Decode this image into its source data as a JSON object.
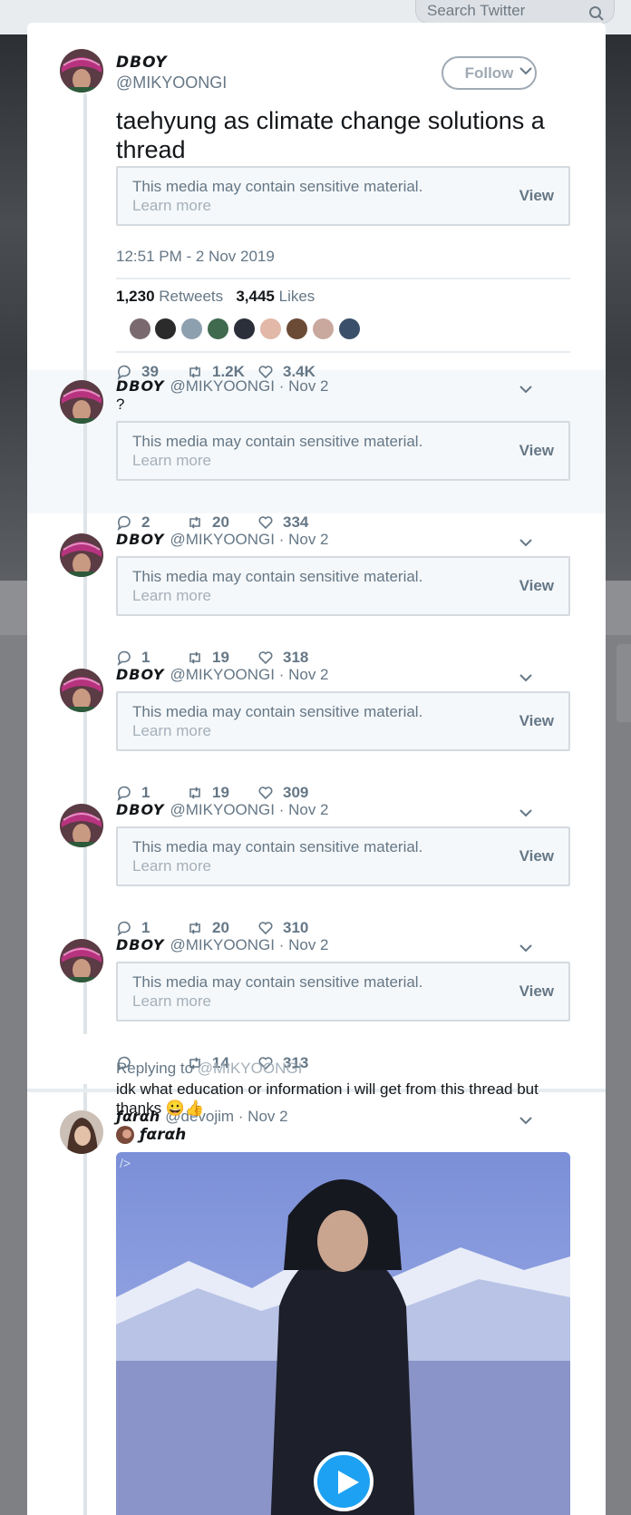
{
  "search": {
    "placeholder": "Search Twitter",
    "icon": "search-icon"
  },
  "main_tweet": {
    "name": "DBOY",
    "handle": "@MIKYOONGI",
    "follow_label": "Follow",
    "text": "taehyung as climate change solutions a thread",
    "media_notice": "This media may contain sensitive material.",
    "learn_more": "Learn more",
    "view_label": "View",
    "timestamp": "12:51 PM - 2 Nov 2019",
    "retweets_count": "1,230",
    "retweets_label": "Retweets",
    "likes_count": "3,445",
    "likes_label": "Likes",
    "replies": "39",
    "retweets_short": "1.2K",
    "likes_short": "3.4K"
  },
  "thread": [
    {
      "name": "DBOY",
      "handle": "@MIKYOONGI · Nov 2",
      "text": "?",
      "media_notice": "This media may contain sensitive material.",
      "learn_more": "Learn more",
      "view_label": "View",
      "replies": "2",
      "retweets": "20",
      "likes": "334"
    },
    {
      "name": "DBOY",
      "handle": "@MIKYOONGI · Nov 2",
      "media_notice": "This media may contain sensitive material.",
      "learn_more": "Learn more",
      "view_label": "View",
      "replies": "1",
      "retweets": "19",
      "likes": "318"
    },
    {
      "name": "DBOY",
      "handle": "@MIKYOONGI · Nov 2",
      "media_notice": "This media may contain sensitive material.",
      "learn_more": "Learn more",
      "view_label": "View",
      "replies": "1",
      "retweets": "19",
      "likes": "309"
    },
    {
      "name": "DBOY",
      "handle": "@MIKYOONGI · Nov 2",
      "media_notice": "This media may contain sensitive material.",
      "learn_more": "Learn more",
      "view_label": "View",
      "replies": "1",
      "retweets": "20",
      "likes": "310"
    },
    {
      "name": "DBOY",
      "handle": "@MIKYOONGI · Nov 2",
      "media_notice": "This media may contain sensitive material.",
      "learn_more": "Learn more",
      "view_label": "View",
      "replies": "",
      "retweets": "14",
      "likes": "313"
    }
  ],
  "farah": {
    "name": "ƒαrαh",
    "handle": "@devojim · Nov 2",
    "replying_prefix": "Replying to",
    "replying_to": "@MIKYOONGI",
    "text": "idk what education or information i will get from this thread but thanks 😀👍",
    "quote_name": "ƒαrαh",
    "video_corner": "/>"
  },
  "colors": {
    "accent": "#1da1f2",
    "muted": "#657786",
    "border": "#d4dadf"
  }
}
